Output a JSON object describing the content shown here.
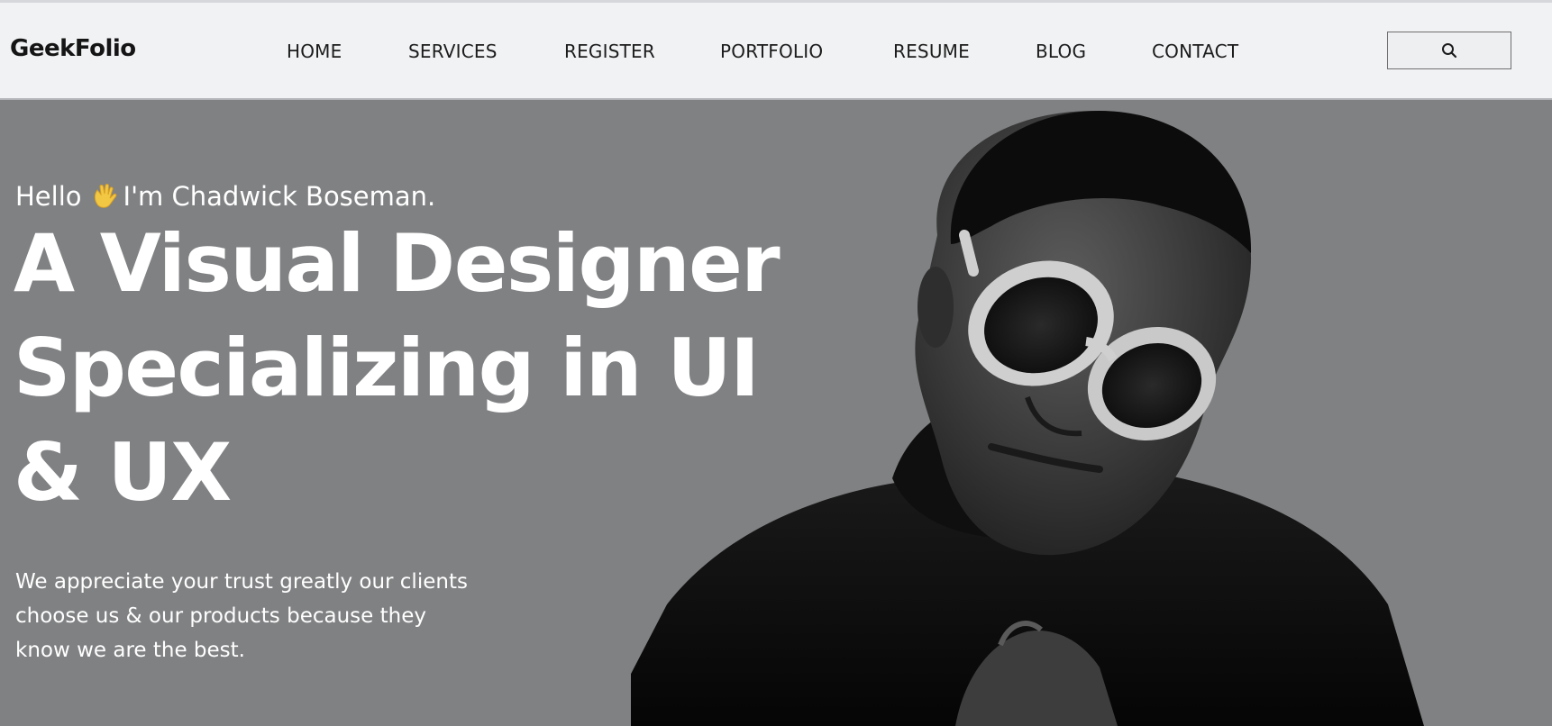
{
  "header": {
    "logo": "GeekFolio",
    "nav": [
      {
        "label": "HOME"
      },
      {
        "label": "SERVICES"
      },
      {
        "label": "REGISTER"
      },
      {
        "label": "PORTFOLIO"
      },
      {
        "label": "RESUME"
      },
      {
        "label": "BLOG"
      },
      {
        "label": "CONTACT"
      }
    ],
    "search_icon": "search-icon"
  },
  "hero": {
    "greeting_hello": "Hello",
    "greeting_emoji": "waving-hand-icon",
    "greeting_name": "I'm Chadwick Boseman.",
    "headline_line1": "A Visual Designer",
    "headline_line2": "Specializing in UI",
    "headline_line3": "& UX",
    "intro_line1": "We appreciate your trust greatly our clients",
    "intro_line2": "choose us & our products because they",
    "intro_line3": "know we are the best.",
    "portrait": "man-with-white-sunglasses-photo"
  },
  "colors": {
    "hero_background": "#808183",
    "header_background": "#f1f2f4",
    "text_light": "#ffffff",
    "text_dark": "#1c1c1c"
  }
}
